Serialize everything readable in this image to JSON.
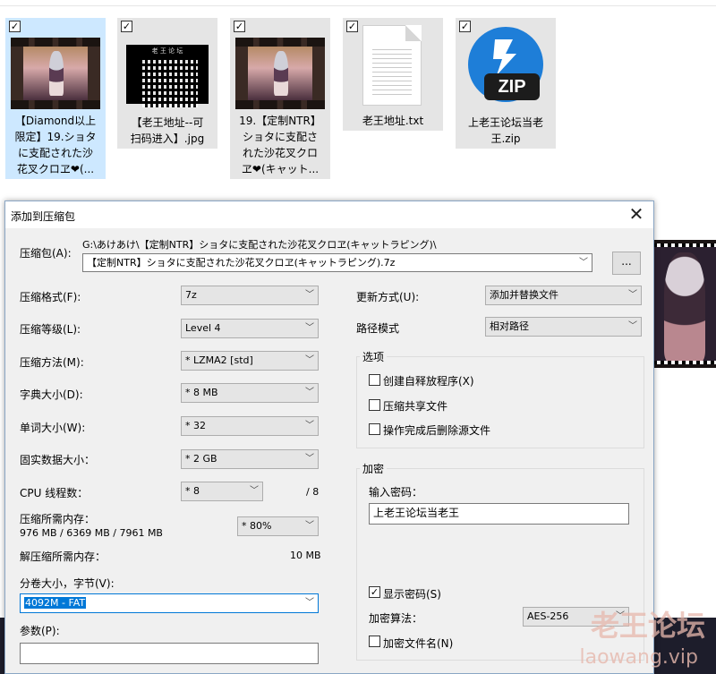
{
  "explorer": {
    "files": [
      {
        "name": "【Diamond以上限定】19.ショタに支配された沙花叉クロヱ❤(...",
        "lines": [
          "【Diamond以上",
          "限定】19.ショタ",
          "に支配された沙",
          "花叉クロヱ❤(..."
        ],
        "type": "video",
        "checked": "✓"
      },
      {
        "name": "【老王地址--可扫码进入】.jpg",
        "lines": [
          "【老王地址--可",
          "扫码进入】.jpg"
        ],
        "type": "image",
        "checked": "✓",
        "qr_header": "老 王 论 坛"
      },
      {
        "name": "19.【定制NTR】ショタに支配された沙花叉クロヱ❤(キャット...",
        "lines": [
          "19.【定制NTR】",
          "ショタに支配さ",
          "れた沙花叉クロ",
          "ヱ❤(キャット..."
        ],
        "type": "video",
        "checked": "✓"
      },
      {
        "name": "老王地址.txt",
        "lines": [
          "老王地址.txt"
        ],
        "type": "text",
        "checked": "✓"
      },
      {
        "name": "上老王论坛当老王.zip",
        "lines": [
          "上老王论坛当老",
          "王.zip"
        ],
        "type": "zip",
        "checked": "✓",
        "icon_label": "ZIP"
      }
    ]
  },
  "dialog": {
    "title": "添加到压缩包",
    "close_label": "✕",
    "archive": {
      "label": "压缩包(A):",
      "path": "G:\\あけあけ\\【定制NTR】ショタに支配された沙花叉クロヱ(キャットラピング)\\",
      "name": "【定制NTR】ショタに支配された沙花叉クロヱ(キャットラピング).7z",
      "browse_label": "..."
    },
    "left": {
      "format": {
        "label": "压缩格式(F):",
        "value": "7z"
      },
      "level": {
        "label": "压缩等级(L):",
        "value": "Level 4"
      },
      "method": {
        "label": "压缩方法(M):",
        "value": "* LZMA2 [std]"
      },
      "dict": {
        "label": "字典大小(D):",
        "value": "* 8 MB"
      },
      "word": {
        "label": "单词大小(W):",
        "value": "* 32"
      },
      "solid": {
        "label": "固实数据大小：",
        "value": "* 2 GB"
      },
      "threads": {
        "label": "CPU 线程数：",
        "value": "* 8",
        "max": "/ 8"
      },
      "mem_compress": {
        "label": "压缩所需内存：",
        "detail": "976 MB / 6369 MB / 7961 MB",
        "percent": "* 80%"
      },
      "mem_decompress": {
        "label": "解压缩所需内存：",
        "value": "10 MB"
      },
      "volume": {
        "label": "分卷大小，字节(V):",
        "value": "4092M - FAT"
      },
      "params": {
        "label": "参数(P):",
        "value": ""
      }
    },
    "right": {
      "update": {
        "label": "更新方式(U):",
        "value": "添加并替换文件"
      },
      "pathmode": {
        "label": "路径模式",
        "value": "相对路径"
      },
      "options": {
        "title": "选项",
        "sfx": "创建自释放程序(X)",
        "shared": "压缩共享文件",
        "delete": "操作完成后删除源文件"
      },
      "encryption": {
        "title": "加密",
        "pwd_label": "输入密码：",
        "pwd_value": "上老王论坛当老王",
        "show_pwd": "显示密码(S)",
        "method_label": "加密算法：",
        "method_value": "AES-256",
        "encrypt_names": "加密文件名(N)"
      }
    }
  },
  "watermark": {
    "line1": "老王论坛",
    "line2": "laowang.vip"
  }
}
